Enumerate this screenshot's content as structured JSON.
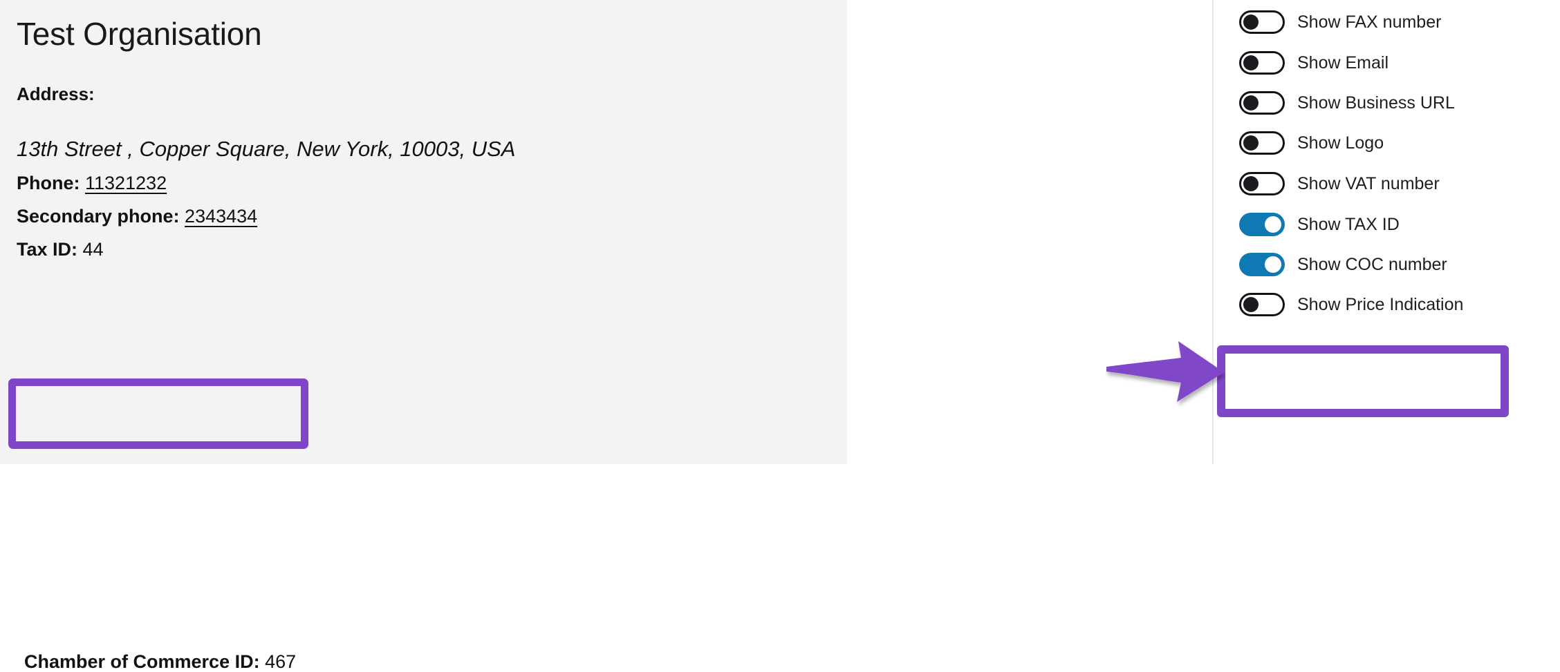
{
  "organisation": {
    "title": "Test Organisation",
    "address_label": "Address:",
    "address_line": "13th Street , Copper Square, New York, 10003, USA",
    "details": [
      {
        "key": "Phone",
        "separator": ": ",
        "value": "11321232",
        "underlined": true
      },
      {
        "key": "Secondary phone",
        "separator": ": ",
        "value": "2343434",
        "underlined": true
      },
      {
        "key": "Tax ID",
        "separator": ": ",
        "value": "44",
        "underlined": false
      },
      {
        "key": "Chamber of Commerce ID",
        "separator": ": ",
        "value": "467",
        "underlined": false
      }
    ]
  },
  "settings": {
    "toggles": [
      {
        "label": "Show FAX number",
        "state": "off"
      },
      {
        "label": "Show Email",
        "state": "off"
      },
      {
        "label": "Show Business URL",
        "state": "off"
      },
      {
        "label": "Show Logo",
        "state": "off"
      },
      {
        "label": "Show VAT number",
        "state": "off"
      },
      {
        "label": "Show TAX ID",
        "state": "on"
      },
      {
        "label": "Show COC number",
        "state": "on"
      },
      {
        "label": "Show Price Indication",
        "state": "off"
      }
    ]
  },
  "annotations": {
    "highlight_color": "#8046c8",
    "arrow_color": "#8046c8",
    "accent_on_color": "#0f79b4",
    "panel_background": "#f2f3f5"
  }
}
